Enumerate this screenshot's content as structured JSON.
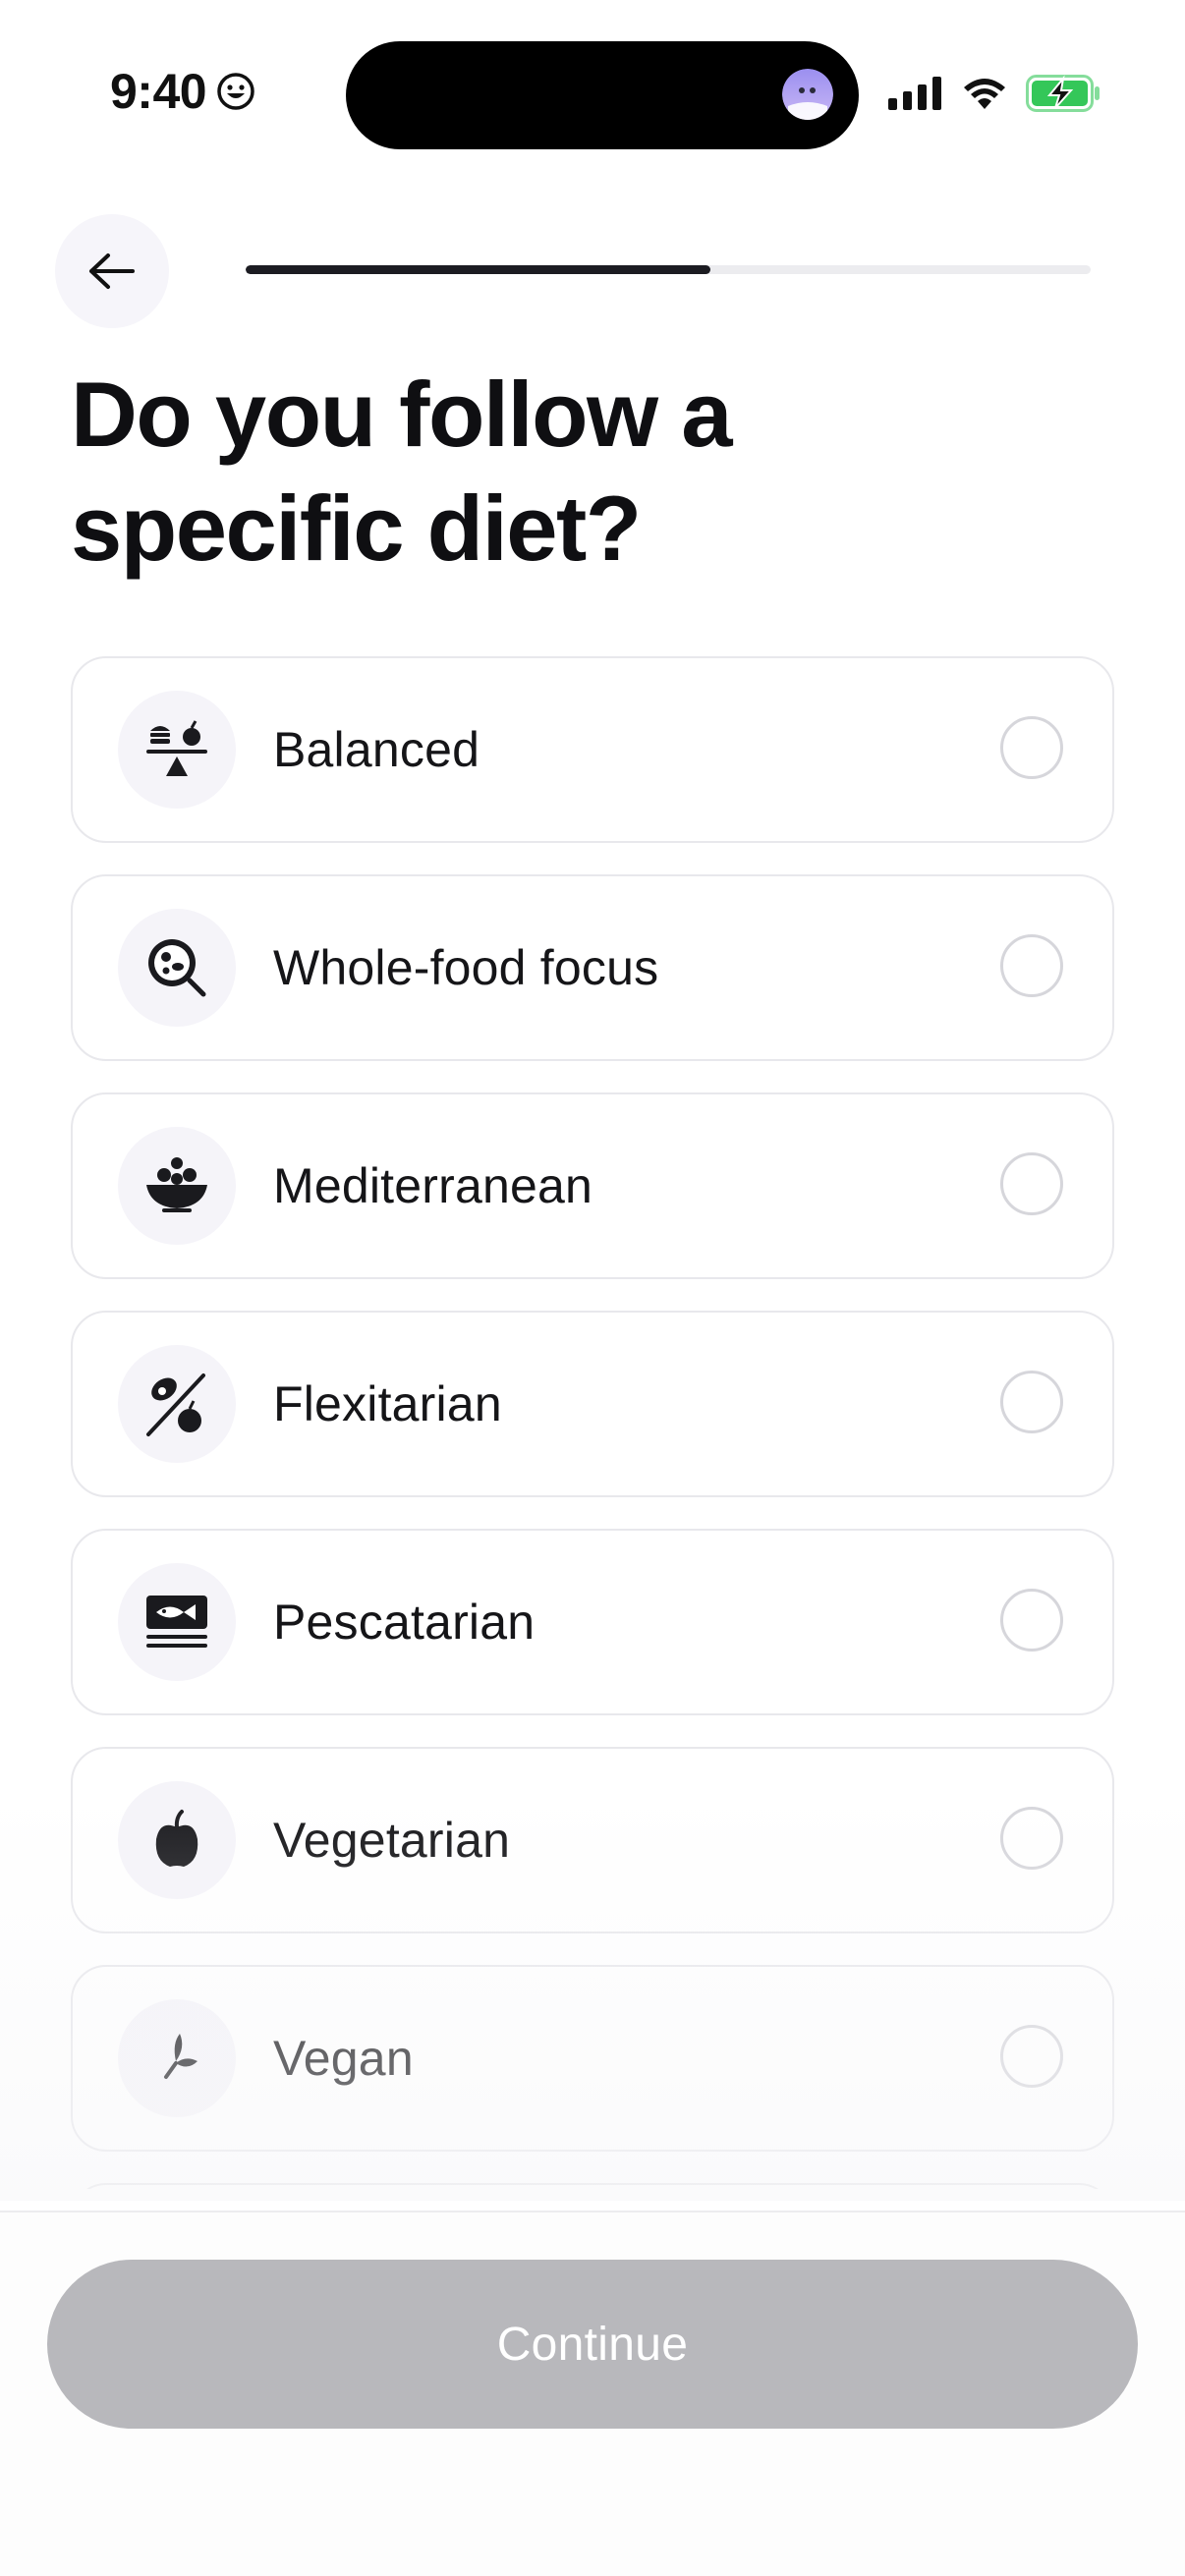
{
  "status_bar": {
    "time": "9:40",
    "battery_color": "#34c759"
  },
  "header": {
    "back_icon": "arrow-left-icon",
    "progress": 0.55
  },
  "title": "Do you follow a specific diet?",
  "options": [
    {
      "label": "Balanced",
      "icon": "balance-scale-food-icon",
      "selected": false
    },
    {
      "label": "Whole-food focus",
      "icon": "food-plate-magnifier-icon",
      "selected": false
    },
    {
      "label": "Mediterranean",
      "icon": "salad-bowl-icon",
      "selected": false
    },
    {
      "label": "Flexitarian",
      "icon": "meat-slash-apple-icon",
      "selected": false
    },
    {
      "label": "Pescatarian",
      "icon": "fish-icon",
      "selected": false
    },
    {
      "label": "Vegetarian",
      "icon": "apple-icon",
      "selected": false
    },
    {
      "label": "Vegan",
      "icon": "leaf-sprout-icon",
      "selected": false
    }
  ],
  "footer": {
    "continue_label": "Continue",
    "continue_color": "#b8b8bc"
  }
}
